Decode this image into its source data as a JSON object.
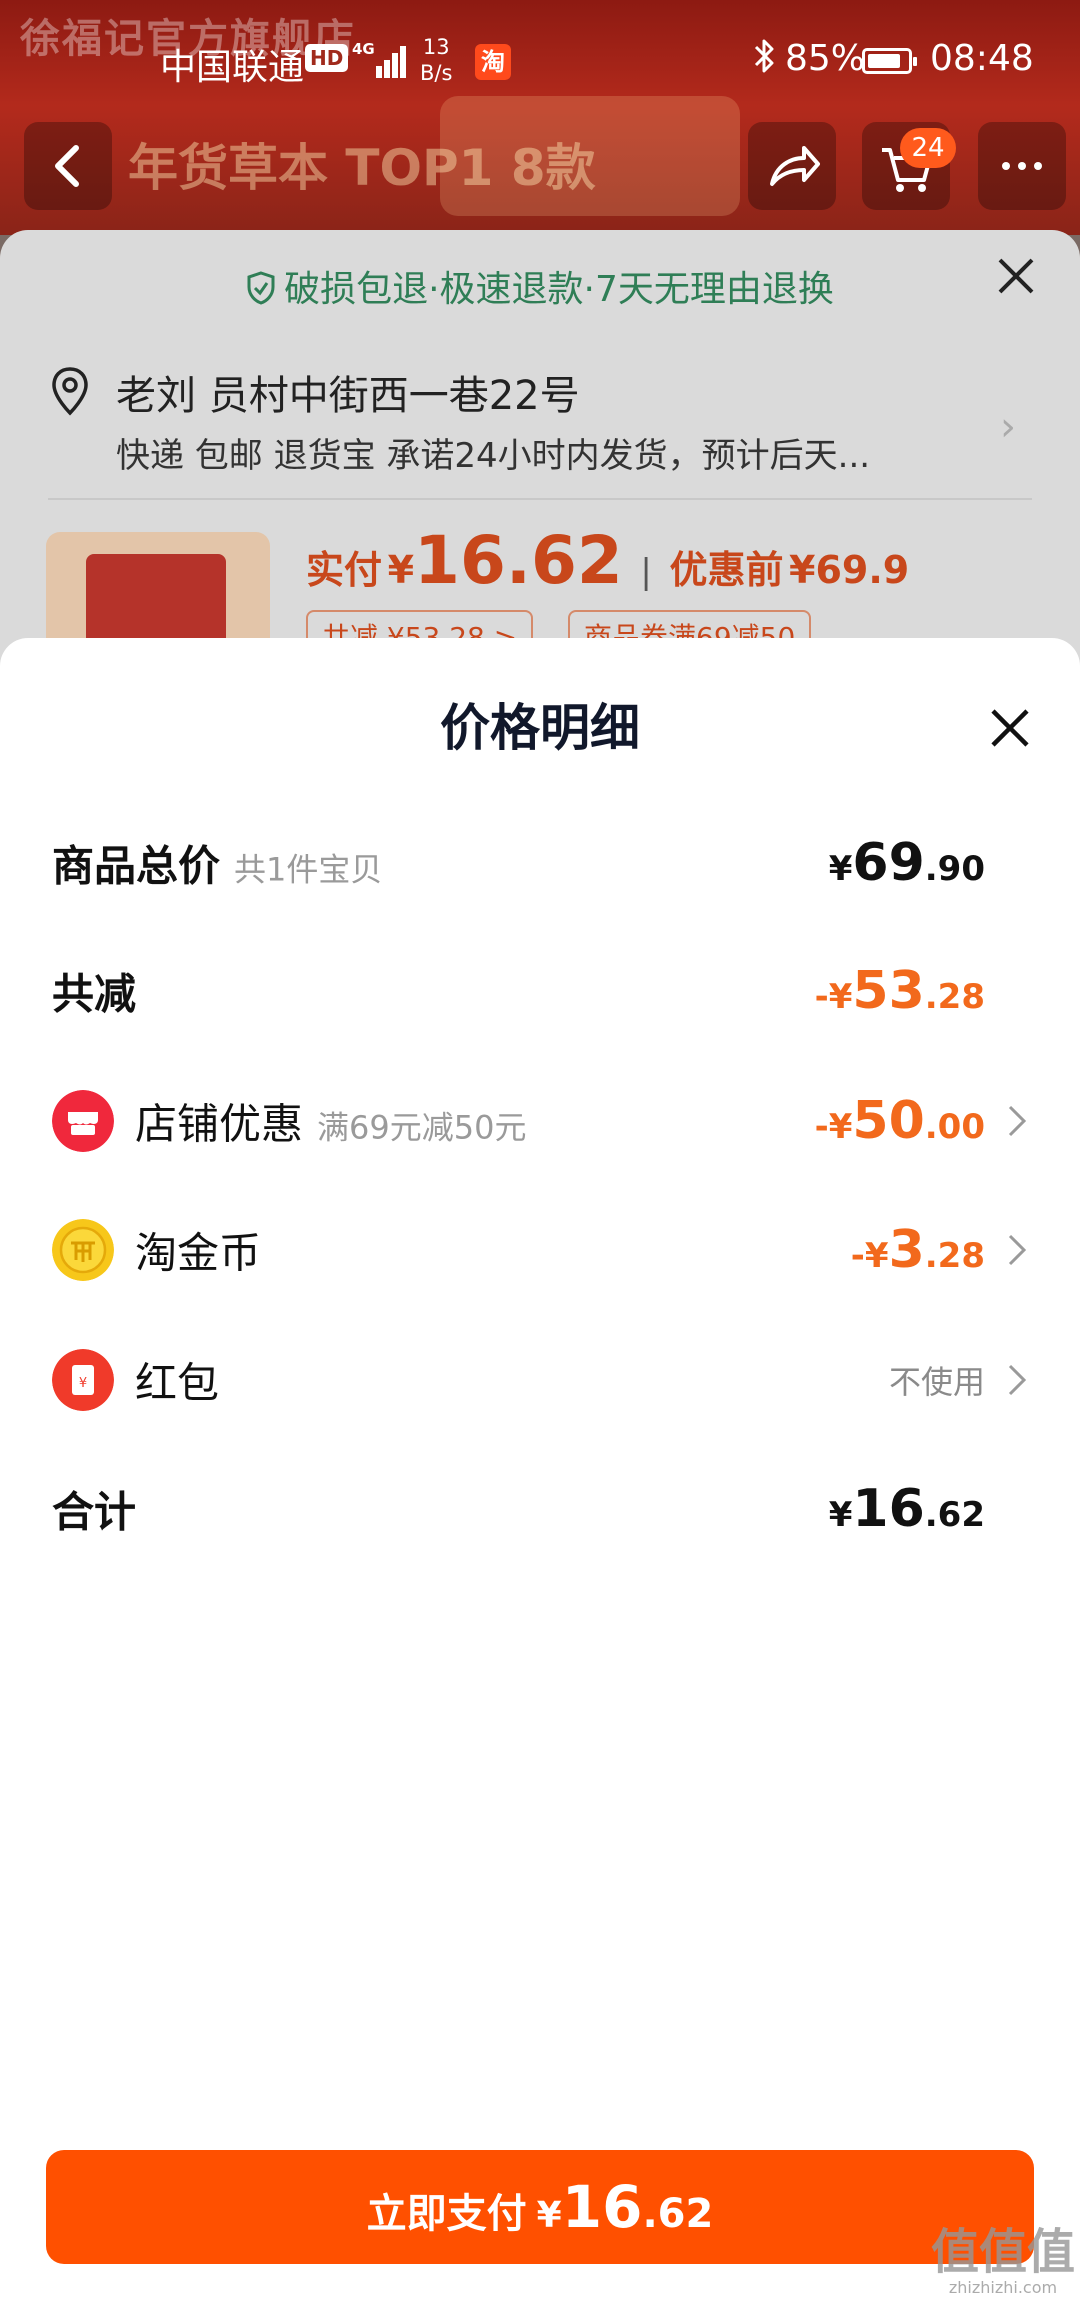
{
  "background": {
    "store_name": "徐福记官方旗舰店",
    "banner_text": "年货草本 TOP1 8款",
    "cart_badge": "24",
    "back_icon": "chevron-left-icon",
    "share_icon": "share-icon",
    "cart_icon": "cart-icon",
    "more_icon": "more-icon"
  },
  "status_bar": {
    "carrier": "中国联通",
    "hd": "HD",
    "network": "4G",
    "speed_value": "13",
    "speed_unit": "B/s",
    "app_badge": "淘",
    "battery": "85%",
    "battery_level": 0.85,
    "time": "08:48"
  },
  "order": {
    "guarantee": "破损包退·极速退款·7天无理由退换",
    "address_name": "老刘 员村中街西一巷22号",
    "shipping": "快递 包邮 退货宝 承诺24小时内发货，预计后天...",
    "paid_label": "实付",
    "paid_yen": "¥",
    "paid_amount": "16.62",
    "separator": "|",
    "before_label": "优惠前",
    "before_amount": "¥69.9",
    "discount_tag": "共减 ¥53.28 >",
    "coupon_tag": "商品券满69减50"
  },
  "detail": {
    "title": "价格明细",
    "rows": {
      "total": {
        "label": "商品总价",
        "sub": "共1件宝贝",
        "yen": "¥",
        "int": "69",
        "dec": ".90"
      },
      "reduce": {
        "label": "共减",
        "prefix": "-¥",
        "int": "53",
        "dec": ".28"
      },
      "store": {
        "label": "店铺优惠",
        "sub": "满69元减50元",
        "prefix": "-¥",
        "int": "50",
        "dec": ".00",
        "icon": "store-icon"
      },
      "coin": {
        "label": "淘金币",
        "prefix": "-¥",
        "int": "3",
        "dec": ".28",
        "icon": "coin-icon"
      },
      "redpacket": {
        "label": "红包",
        "value": "不使用",
        "icon": "red-packet-icon"
      },
      "sum": {
        "label": "合计",
        "yen": "¥",
        "int": "16",
        "dec": ".62"
      }
    },
    "pay_button": {
      "label": "立即支付",
      "yen": "¥",
      "int": "16",
      "dec": ".62"
    }
  },
  "watermark": {
    "big": "值值值",
    "small": "zhizhizhi.com"
  },
  "colors": {
    "accent": "#ff5000",
    "discount": "#f2691c",
    "guarantee": "#2f7e56"
  }
}
